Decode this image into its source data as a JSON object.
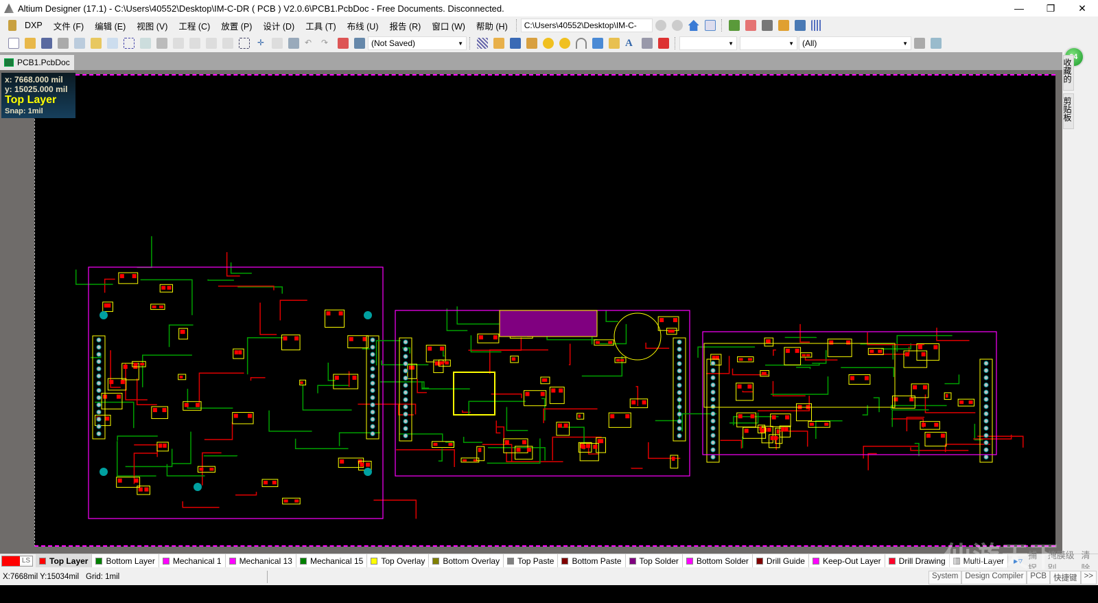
{
  "window": {
    "title": "Altium Designer (17.1) - C:\\Users\\40552\\Desktop\\IM-C-DR ( PCB ) V2.0.6\\PCB1.PcbDoc - Free Documents. Disconnected.",
    "minimize": "—",
    "restore": "❐",
    "close": "✕"
  },
  "menu": {
    "items": [
      "DXP",
      "文件 (F)",
      "编辑 (E)",
      "视图 (V)",
      "工程 (C)",
      "放置 (P)",
      "设计 (D)",
      "工具 (T)",
      "布线 (U)",
      "报告 (R)",
      "窗口 (W)",
      "帮助 (H)"
    ],
    "path": "C:\\Users\\40552\\Desktop\\IM-C-"
  },
  "toolbar": {
    "variant": "(Not Saved)",
    "filter1": "",
    "filter2": "",
    "filter3": "(All)"
  },
  "tabs": {
    "doc": "PCB1.PcbDoc"
  },
  "hud": {
    "x": "x:  7668.000  mil",
    "y": "y: 15025.000  mil",
    "layer": "Top Layer",
    "snap": "Snap: 1mil"
  },
  "rightpanel": {
    "badge": "64",
    "tab1": "收藏的",
    "tab2": "剪贴板"
  },
  "layers": {
    "ls": "LS",
    "items": [
      {
        "name": "Top Layer",
        "color": "#ff0000"
      },
      {
        "name": "Bottom Layer",
        "color": "#008000"
      },
      {
        "name": "Mechanical 1",
        "color": "#ff00ff"
      },
      {
        "name": "Mechanical 13",
        "color": "#ff00ff"
      },
      {
        "name": "Mechanical 15",
        "color": "#008000"
      },
      {
        "name": "Top Overlay",
        "color": "#ffff00"
      },
      {
        "name": "Bottom Overlay",
        "color": "#808000"
      },
      {
        "name": "Top Paste",
        "color": "#808080"
      },
      {
        "name": "Bottom Paste",
        "color": "#800000"
      },
      {
        "name": "Top Solder",
        "color": "#800080"
      },
      {
        "name": "Bottom Solder",
        "color": "#ff00ff"
      },
      {
        "name": "Drill Guide",
        "color": "#800000"
      },
      {
        "name": "Keep-Out Layer",
        "color": "#ff00ff"
      },
      {
        "name": "Drill Drawing",
        "color": "#ff002a"
      },
      {
        "name": "Multi-Layer",
        "color": "#c0c0c0"
      }
    ],
    "snap": "捕捉",
    "mask": "掩膜级别",
    "clear": "清除"
  },
  "status": {
    "coords": "X:7668mil Y:15034mil",
    "grid": "Grid: 1mil",
    "buttons": [
      "System",
      "Design Compiler",
      "PCB",
      "快捷键",
      ">>"
    ]
  },
  "watermark": "仙游天下"
}
